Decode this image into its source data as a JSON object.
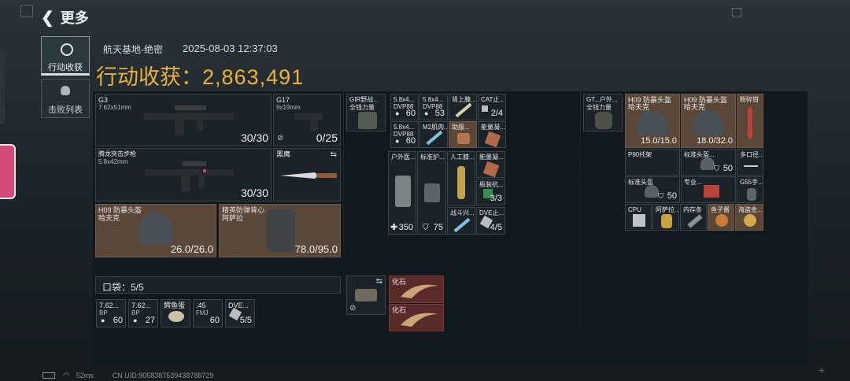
{
  "header": {
    "back_label": "更多"
  },
  "tabs": [
    {
      "label": "行动收获"
    },
    {
      "label": "击败列表"
    }
  ],
  "summary": {
    "map": "航天基地-绝密",
    "datetime": "2025-08-03 12:37:03",
    "title_prefix": "行动收获：",
    "value": "2,863,491"
  },
  "weapons": [
    {
      "name": "G3",
      "ammo": "7.62x51mm",
      "count": "30/30"
    },
    {
      "name": "G17",
      "ammo": "9x19mm",
      "count": "0/25"
    },
    {
      "name": "腾龙突击步枪",
      "ammo": "5.8x42mm",
      "count": "30/30"
    },
    {
      "name": "黑鹰",
      "ammo": "",
      "count": ""
    }
  ],
  "gear": [
    {
      "name": "H09 防暴头盔",
      "sub": "哈夫克",
      "durability": "26.0/26.0"
    },
    {
      "name": "精英防弹背心",
      "sub": "阿萨拉",
      "durability": "78.0/95.0"
    }
  ],
  "pocket": {
    "label": "口袋：5/5",
    "items": [
      {
        "name": "7.62...",
        "sub": "BP",
        "count": "60"
      },
      {
        "name": "7.62...",
        "sub": "BP",
        "count": "27"
      },
      {
        "name": "鳄鱼蛋",
        "count": ""
      },
      {
        "name": ".45",
        "sub": "FMJ",
        "count": "60"
      },
      {
        "name": "DVE...",
        "count": "5/5"
      }
    ]
  },
  "rig": {
    "name": "GIR野战...",
    "sub": "全钱力量"
  },
  "rig_items": [
    {
      "name": "5.8x4...",
      "sub": "DVP88",
      "count": "60"
    },
    {
      "name": "5.8x4...",
      "sub": "DVP88",
      "count": "53"
    },
    {
      "name": "肾上腺...",
      "count": ""
    },
    {
      "name": "CAT止...",
      "count": "2/4"
    },
    {
      "name": "5.8x4...",
      "sub": "DVP88",
      "count": "60"
    },
    {
      "name": "M2肌肉...",
      "count": ""
    },
    {
      "name": "助服...",
      "count": ""
    },
    {
      "name": "能量凝...",
      "count": ""
    },
    {
      "name": "户外医...",
      "count": "350"
    },
    {
      "name": "标准护...",
      "count": "75"
    },
    {
      "name": "人工膝...",
      "count": ""
    },
    {
      "name": "能量凝...",
      "count": ""
    },
    {
      "name": "瓶装抗...",
      "count": "3/3"
    },
    {
      "name": "战斗兴...",
      "count": ""
    },
    {
      "name": "DVE止...",
      "count": "4/5"
    }
  ],
  "secure": [
    {
      "name": "化石"
    },
    {
      "name": "化石"
    }
  ],
  "backpack": {
    "name": "GT...户外...",
    "sub": "全钱力量"
  },
  "backpack_items": [
    {
      "name": "H09 防暴头盔",
      "sub": "哈夫克",
      "count": "15.0/15.0"
    },
    {
      "name": "H09 防暴头盔",
      "sub": "哈夫克",
      "count": "18.0/32.0"
    },
    {
      "name": "粉碎钳",
      "count": ""
    },
    {
      "name": "P90托架",
      "count": ""
    },
    {
      "name": "标准头盔...",
      "count": "50"
    },
    {
      "name": "多口径...",
      "count": ""
    },
    {
      "name": "标准头盔",
      "count": "50"
    },
    {
      "name": "专业...",
      "count": ""
    },
    {
      "name": "G55手...",
      "count": ""
    },
    {
      "name": "CPU",
      "count": ""
    },
    {
      "name": "阿萨拉...",
      "count": ""
    },
    {
      "name": "内存条",
      "count": ""
    },
    {
      "name": "鱼子酱",
      "count": ""
    },
    {
      "name": "海盗金...",
      "count": ""
    }
  ],
  "status": {
    "ping": "52ms",
    "uid": "CN UID:9058387539438788729"
  },
  "colors": {
    "gold": "#e9b23a",
    "panel": "#12191e",
    "slot": "#1b2329",
    "brown": "#5a4737",
    "red": "#5a2a28"
  }
}
